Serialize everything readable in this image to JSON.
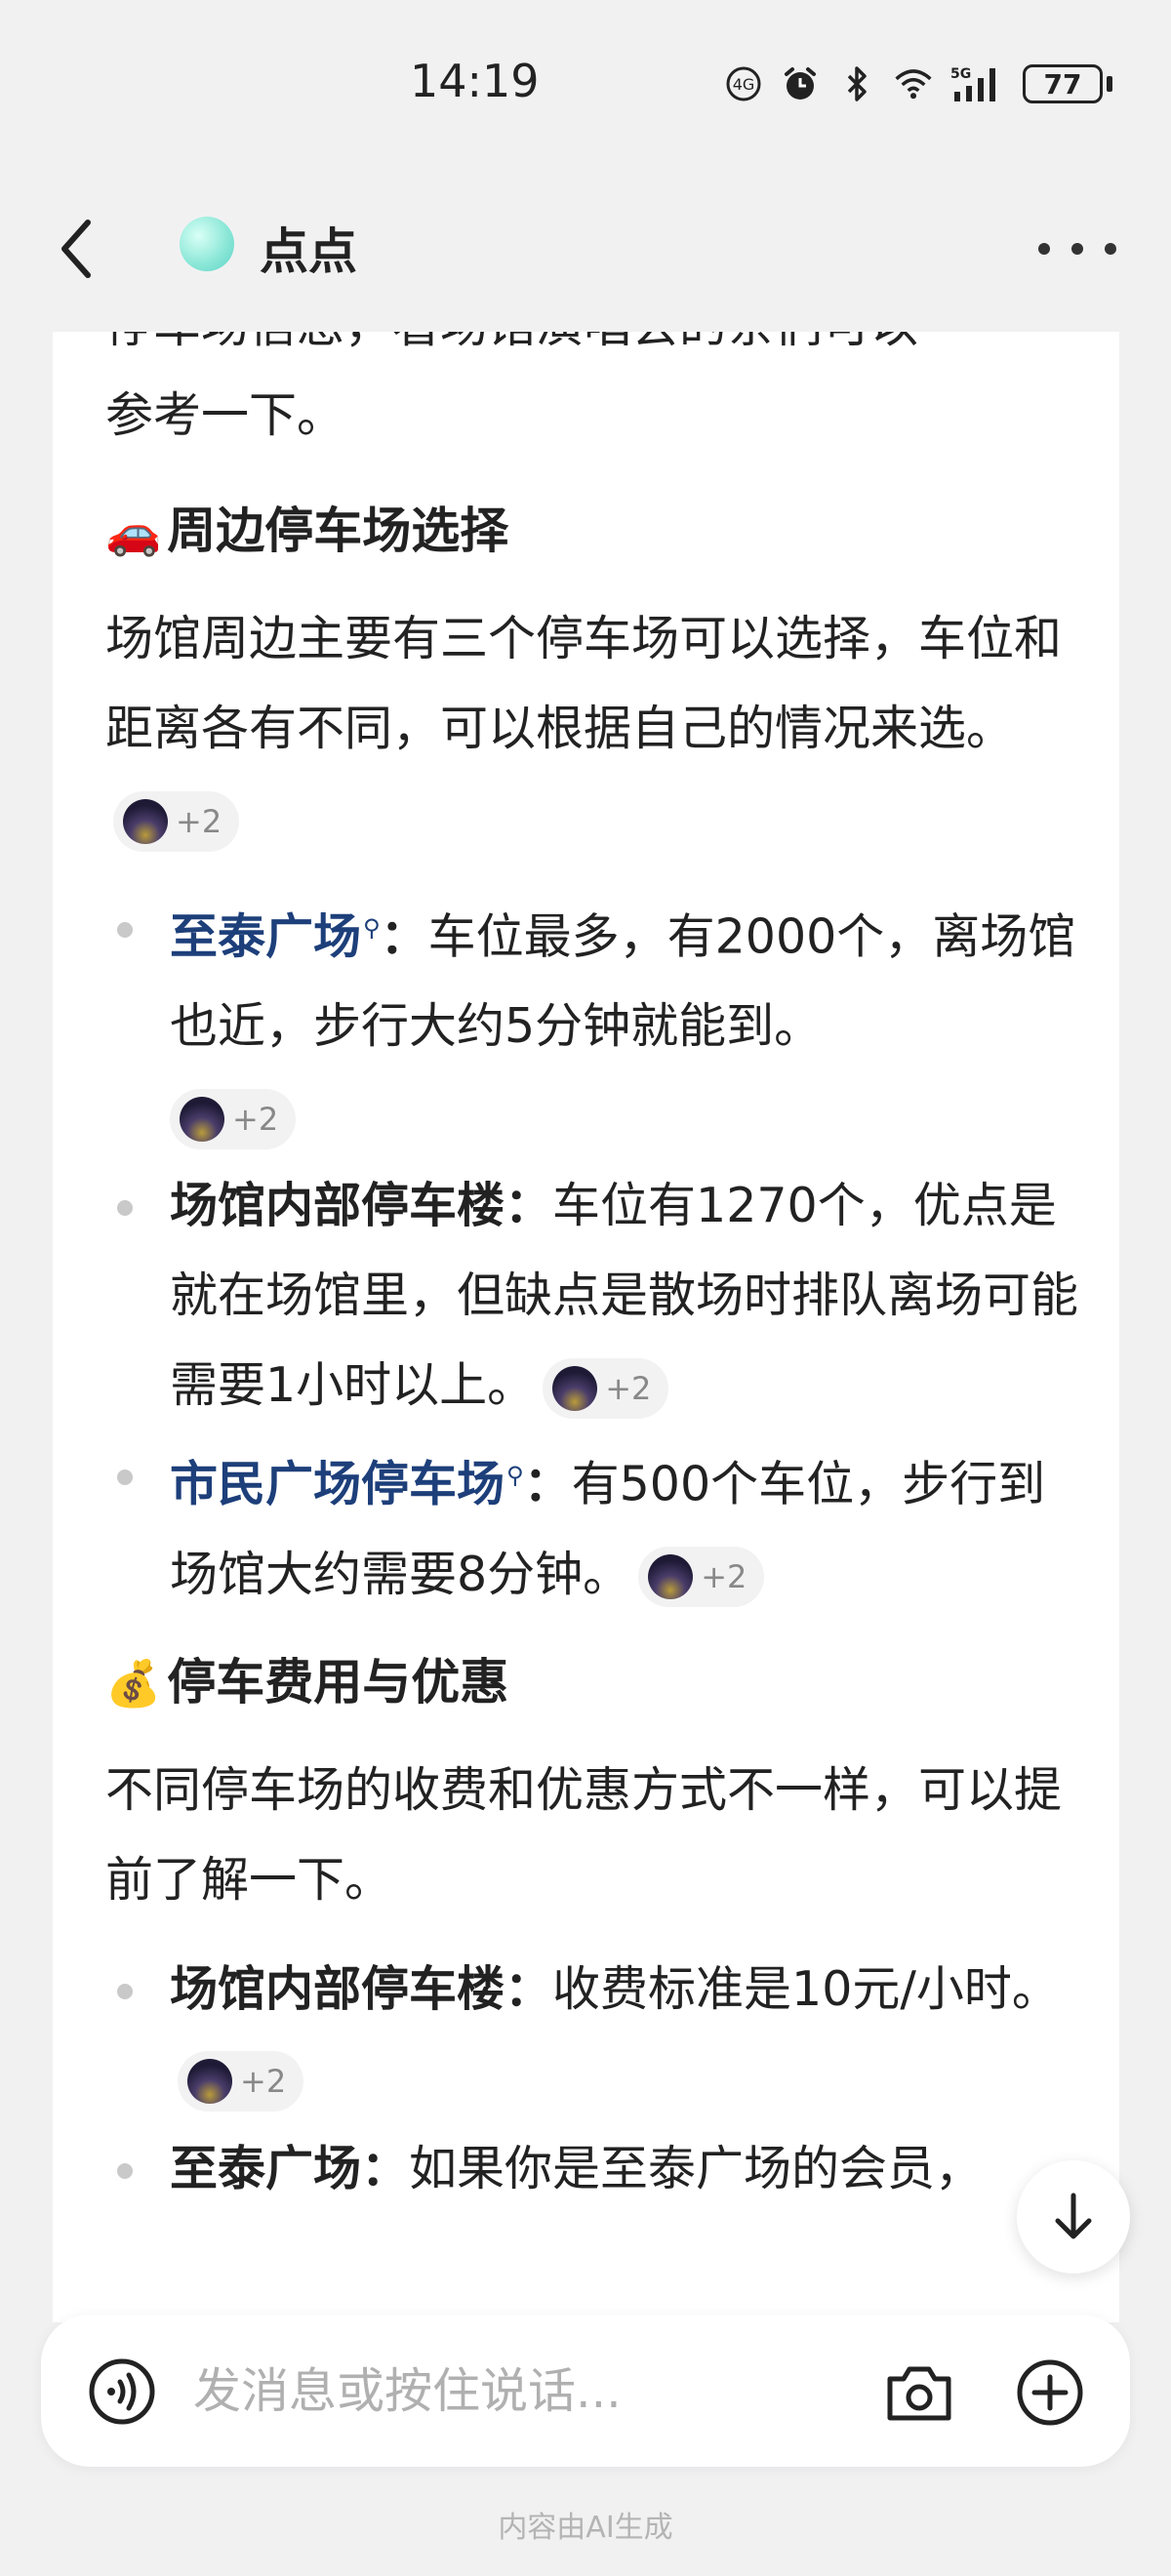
{
  "status_bar": {
    "time": "14:19",
    "battery": "77",
    "icons": [
      "hd-call-icon",
      "alarm-icon",
      "bluetooth-icon",
      "wifi-icon",
      "5g-signal-icon"
    ]
  },
  "header": {
    "title": "点点",
    "back_icon": "back-chevron-icon",
    "more_icon": "more-dots-icon"
  },
  "message": {
    "intro_fragment": "停车场信息，看场馆演唱会的亲们可以",
    "intro_end": "参考一下。",
    "section1": {
      "emoji": "🚗",
      "title": "周边停车场选择",
      "text": "场馆周边主要有三个停车场可以选择，车位和距离各有不同，可以根据自己的情况来选。",
      "cite_count": "+2",
      "items": [
        {
          "name": "至泰广场",
          "linked": true,
          "colon": "：",
          "text": "车位最多，有2000个，离场馆也近，步行大约5分钟就能到。",
          "cite_count": "+2"
        },
        {
          "name": "场馆内部停车楼",
          "linked": false,
          "colon": "：",
          "text": "车位有1270个，优点是就在场馆里，但缺点是散场时排队离场可能需要1小时以上。",
          "cite_count": "+2"
        },
        {
          "name": "市民广场停车场",
          "linked": true,
          "colon": "：",
          "text": "有500个车位，步行到场馆大约需要8分钟。",
          "cite_count": "+2"
        }
      ]
    },
    "section2": {
      "emoji": "💰",
      "title": "停车费用与优惠",
      "text": "不同停车场的收费和优惠方式不一样，可以提前了解一下。",
      "items": [
        {
          "name": "场馆内部停车楼",
          "colon": "：",
          "text": "收费标准是10元/小时。",
          "cite_count": "+2"
        },
        {
          "name": "至泰广场",
          "colon": "：",
          "text": "如果你是至泰广场的会员，"
        }
      ]
    }
  },
  "input": {
    "placeholder": "发消息或按住说话...",
    "voice_icon": "voice-wave-icon",
    "camera_icon": "camera-icon",
    "plus_icon": "plus-circle-icon"
  },
  "footer_note": "内容由AI生成"
}
